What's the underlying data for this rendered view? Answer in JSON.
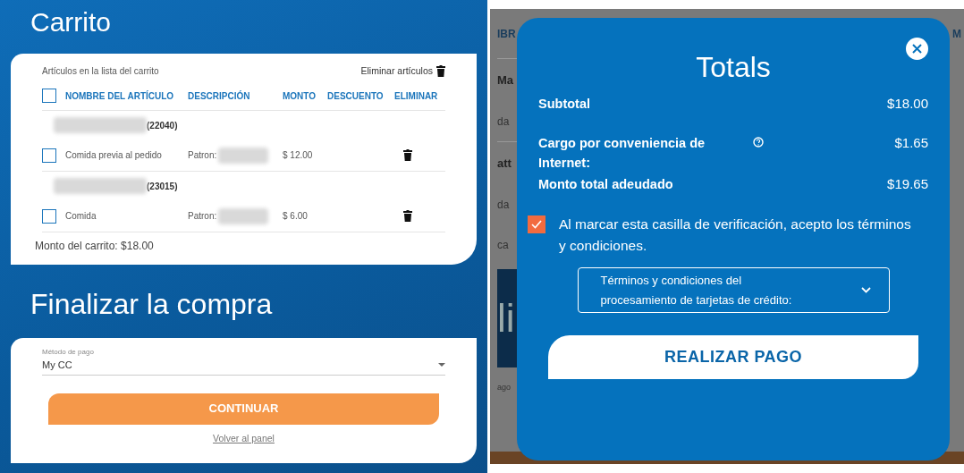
{
  "cart_page": {
    "title": "Carrito",
    "cart_card": {
      "caption": "Artículos en la lista del carrito",
      "remove_items": "Eliminar artículos",
      "select_all_checked": false,
      "columns": [
        "NOMBRE DEL ARTÍCULO",
        "DESCRIPCIÓN",
        "MONTO",
        "DESCUENTO",
        "ELIMINAR"
      ],
      "groups": [
        {
          "code": "(22040)",
          "items": [
            {
              "name": "Comida previa al pedido",
              "description_label": "Patron:",
              "amount": "$ 12.00",
              "checked": false
            }
          ]
        },
        {
          "code": "(23015)",
          "items": [
            {
              "name": "Comida",
              "description_label": "Patron:",
              "amount": "$ 6.00",
              "checked": false
            }
          ]
        }
      ],
      "cart_total": "Monto del carrito: $18.00"
    },
    "checkout_title": "Finalizar la compra",
    "checkout_card": {
      "payment_label": "Método de pago",
      "payment_value": "My CC",
      "continue_button": "CONTINUAR",
      "back_link": "Volver al panel"
    }
  },
  "totals_page": {
    "backdrop": {
      "left": [
        {
          "text": "IBR",
          "kind": "header"
        },
        {
          "text": "Ma",
          "kind": "bold"
        },
        {
          "text": "da",
          "kind": "plain"
        },
        {
          "text": "att",
          "kind": "bold"
        },
        {
          "text": "da",
          "kind": "plain"
        },
        {
          "text": "ca",
          "kind": "plain"
        },
        {
          "text": "li",
          "kind": "banner"
        },
        {
          "text": "ago",
          "kind": "small"
        }
      ],
      "right": [
        {
          "text": "M",
          "kind": "header"
        }
      ]
    },
    "modal": {
      "title": "Totals",
      "rows": [
        {
          "label": "Subtotal",
          "value": "$18.00",
          "help": false
        },
        {
          "label": "Cargo por conveniencia de Internet:",
          "value": "$1.65",
          "help": true
        },
        {
          "label": "Monto total adeudado",
          "value": "$19.65",
          "help": false
        }
      ],
      "terms_checked": true,
      "terms_text": "Al marcar esta casilla de verificación, acepto los términos y condiciones.",
      "terms_dropdown": "Términos y condiciones del procesamiento de tarjetas de crédito:",
      "pay_button": "REALIZAR PAGO"
    }
  }
}
